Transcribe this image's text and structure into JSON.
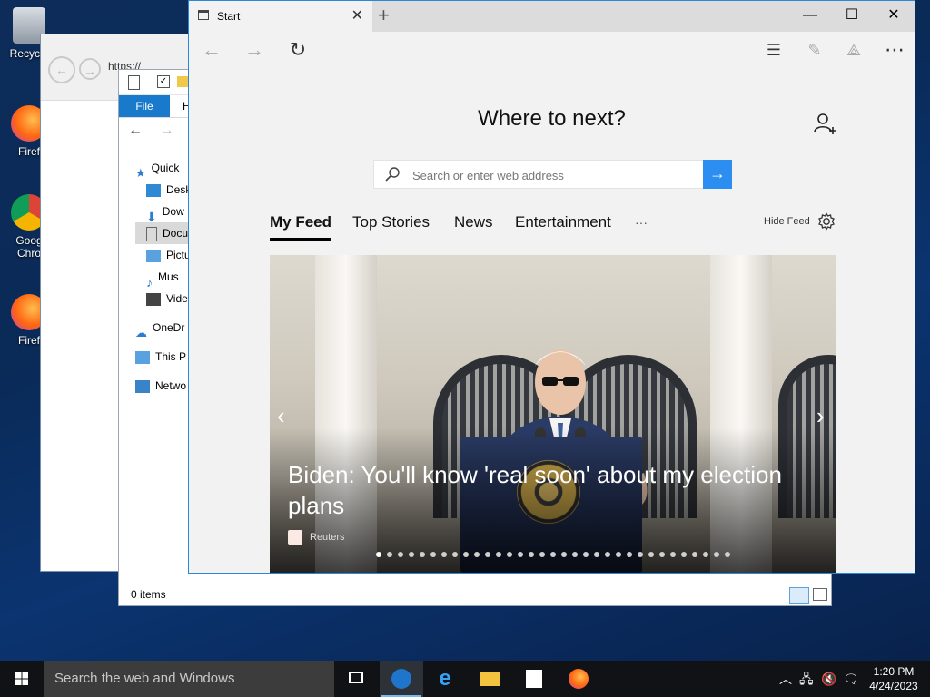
{
  "desktop": {
    "icons": [
      {
        "label": "Recycle"
      },
      {
        "label": "Firef"
      },
      {
        "label": "Goog Chro"
      },
      {
        "label": "Firef"
      }
    ]
  },
  "back_window": {
    "address_fragment": "https://"
  },
  "explorer": {
    "file_tab": "File",
    "home_tab_fragment": "H",
    "nav_items": [
      "Quick",
      "Desk",
      "Dow",
      "Docu",
      "Pictu",
      "Mus",
      "Vide",
      "OneDr",
      "This P",
      "Netwo"
    ],
    "status": "0 items"
  },
  "edge": {
    "tab_title": "Start",
    "heading": "Where to next?",
    "search_placeholder": "Search or enter web address",
    "feed_tabs": [
      "My Feed",
      "Top Stories",
      "News",
      "Entertainment",
      "···"
    ],
    "hide_feed": "Hide Feed",
    "hero": {
      "headline": "Biden: You'll know 'real soon' about my election plans",
      "source": "Reuters",
      "slide_count": 33,
      "active_slide": 1
    }
  },
  "taskbar": {
    "search_placeholder": "Search the web and Windows",
    "time": "1:20 PM",
    "date": "4/24/2023"
  },
  "colors": {
    "accent": "#2b8ef0",
    "file_tab": "#1979ca",
    "taskbar": "#101216"
  }
}
